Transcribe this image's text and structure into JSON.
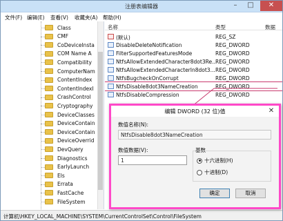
{
  "window": {
    "title": "注册表编辑器",
    "minimize_icon": "minimize-icon",
    "maximize_icon": "maximize-icon",
    "close_icon": "close-icon"
  },
  "menu": [
    "文件(F)",
    "编辑(E)",
    "查看(V)",
    "收藏夹(A)",
    "帮助(H)"
  ],
  "tree": {
    "items": [
      "Class",
      "CMF",
      "CoDeviceInsta",
      "COM Name A",
      "Compatibility",
      "ComputerNam",
      "ContentIndex",
      "ContentIndexI",
      "CrashControl",
      "Cryptography",
      "DeviceClasses",
      "DeviceContain",
      "DeviceContain",
      "DeviceOverrid",
      "DevQuery",
      "Diagnostics",
      "EarlyLaunch",
      "Els",
      "Errata",
      "FastCache",
      "FileSystem"
    ]
  },
  "list": {
    "headers": {
      "name": "名称",
      "type": "类型",
      "data": "数据"
    },
    "rows": [
      {
        "name": "(默认)",
        "type": "REG_SZ",
        "kind": "string"
      },
      {
        "name": "DisableDeleteNotification",
        "type": "REG_DWORD",
        "kind": "dword"
      },
      {
        "name": "FilterSupportedFeaturesMode",
        "type": "REG_DWORD",
        "kind": "dword"
      },
      {
        "name": "NtfsAllowExtendedCharacter8dot3Re...",
        "type": "REG_DWORD",
        "kind": "dword"
      },
      {
        "name": "NtfsAllowExtendedCharacterIn8dot3...",
        "type": "REG_DWORD",
        "kind": "dword"
      },
      {
        "name": "NtfsBugcheckOnCorrupt",
        "type": "REG_DWORD",
        "kind": "dword"
      },
      {
        "name": "NtfsDisable8dot3NameCreation",
        "type": "REG_DWORD",
        "kind": "dword",
        "selected": true
      },
      {
        "name": "NtfsDisableCompression",
        "type": "REG_DWORD",
        "kind": "dword"
      }
    ]
  },
  "status": {
    "path": "计算机\\HKEY_LOCAL_MACHINE\\SYSTEM\\CurrentControlSet\\Control\\FileSystem"
  },
  "dialog": {
    "title": "编辑 DWORD (32 位)值",
    "value_name_label": "数值名称(N):",
    "value_name": "NtfsDisable8dot3NameCreation",
    "value_data_label": "数值数据(V):",
    "value_data": "1",
    "base_label": "基数",
    "base_hex": "● 十六进制(H)",
    "base_dec": "十进制(D)",
    "ok": "确定",
    "cancel": "取消"
  },
  "colors": {
    "highlight_border": "#ff49c8",
    "annotation_arrow": "#c83a6e"
  }
}
